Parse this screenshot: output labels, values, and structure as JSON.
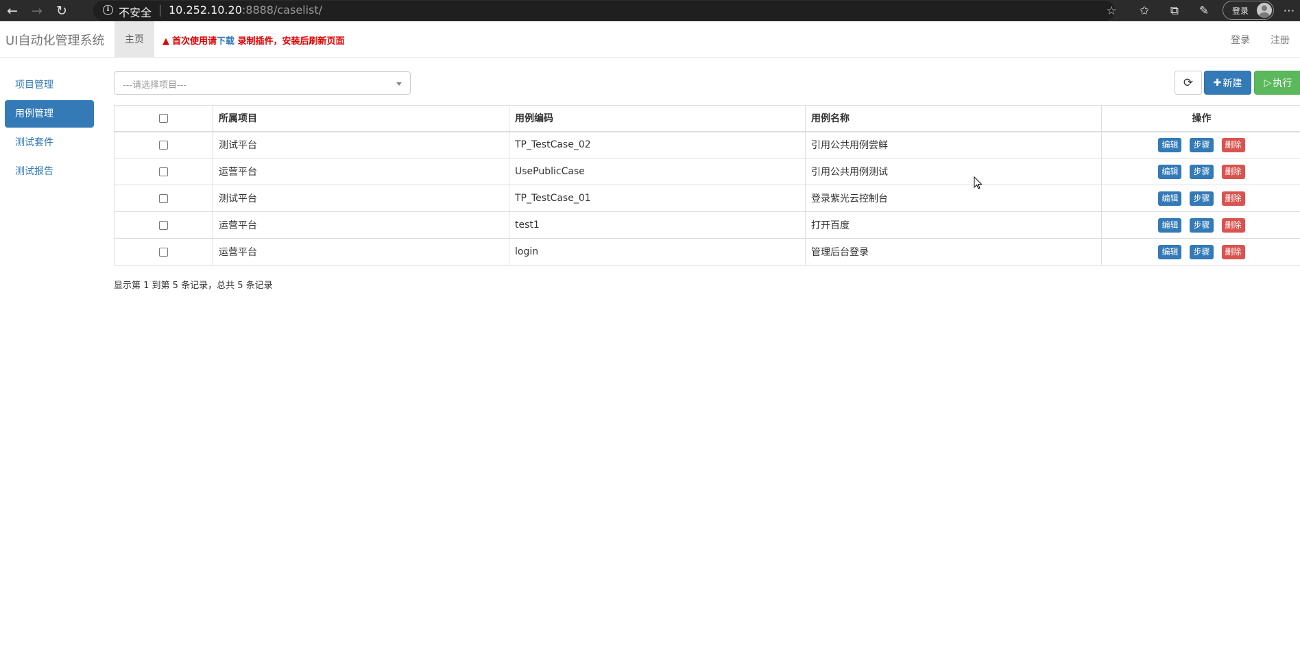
{
  "browser": {
    "insecure_label": "不安全",
    "url_host": "10.252.10.20",
    "url_rest": ":8888/caselist/",
    "profile_label": "登录"
  },
  "app": {
    "brand": "UI自动化管理系统",
    "home_tab": "主页",
    "notice": {
      "prefix": "首次使用请",
      "link": "下载",
      "suffix": " 录制插件，安装后刷新页面"
    },
    "nav_login": "登录",
    "nav_register": "注册"
  },
  "sidebar": {
    "items": [
      {
        "label": "项目管理",
        "active": false
      },
      {
        "label": "用例管理",
        "active": true
      },
      {
        "label": "测试套件",
        "active": false
      },
      {
        "label": "测试报告",
        "active": false
      }
    ]
  },
  "toolbar": {
    "project_placeholder": "---请选择项目---",
    "new_label": "新建",
    "exec_label": "执行"
  },
  "table": {
    "columns": [
      "所属项目",
      "用例编码",
      "用例名称",
      "操作"
    ],
    "rows": [
      {
        "project": "测试平台",
        "code": "TP_TestCase_02",
        "name": "引用公共用例尝鲜"
      },
      {
        "project": "运营平台",
        "code": "UsePublicCase",
        "name": "引用公共用例测试"
      },
      {
        "project": "测试平台",
        "code": "TP_TestCase_01",
        "name": "登录紫光云控制台"
      },
      {
        "project": "运营平台",
        "code": "test1",
        "name": "打开百度"
      },
      {
        "project": "运营平台",
        "code": "login",
        "name": "管理后台登录"
      }
    ],
    "actions": {
      "edit": "编辑",
      "step": "步骤",
      "delete": "删除"
    }
  },
  "pager": {
    "info": "显示第 1 到第 5 条记录，总共 5 条记录"
  },
  "colors": {
    "primary": "#337ab7",
    "success": "#5cb85c",
    "danger": "#d9534f",
    "notice_red": "#e00000"
  }
}
